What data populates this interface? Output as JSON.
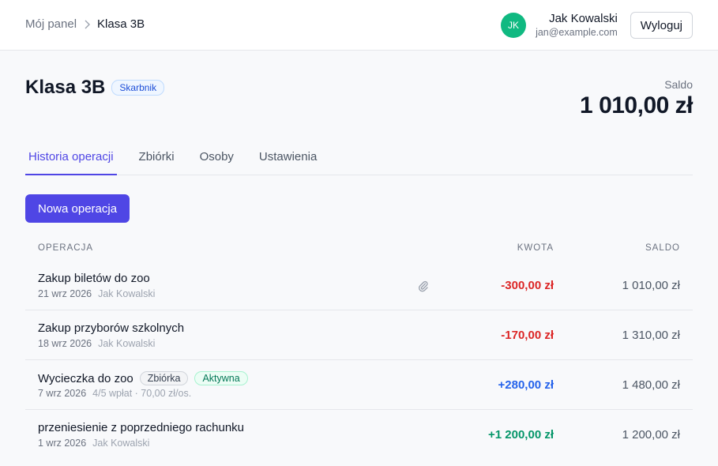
{
  "breadcrumb": {
    "home": "Mój panel",
    "current": "Klasa 3B"
  },
  "user": {
    "initials": "JK",
    "name": "Jak Kowalski",
    "email": "jan@example.com",
    "logout_label": "Wyloguj",
    "avatar_color": "#10b981"
  },
  "page": {
    "title": "Klasa 3B",
    "role_badge": "Skarbnik",
    "balance_label": "Saldo",
    "balance_value": "1 010,00 zł"
  },
  "tabs": [
    {
      "label": "Historia operacji",
      "active": true
    },
    {
      "label": "Zbiórki",
      "active": false
    },
    {
      "label": "Osoby",
      "active": false
    },
    {
      "label": "Ustawienia",
      "active": false
    }
  ],
  "new_operation_label": "Nowa operacja",
  "table": {
    "headers": {
      "operation": "OPERACJA",
      "amount": "KWOTA",
      "balance": "SALDO"
    },
    "rows": [
      {
        "title": "Zakup biletów do zoo",
        "date": "21 wrz 2026",
        "author": "Jak Kowalski",
        "amount": "-300,00 zł",
        "balance": "1 010,00 zł",
        "attachment_icon": "paperclip-icon"
      },
      {
        "title": "Zakup przyborów szkolnych",
        "date": "18 wrz 2026",
        "author": "Jak Kowalski",
        "amount": "-170,00 zł",
        "balance": "1 310,00 zł"
      },
      {
        "title": "Wycieczka do zoo",
        "chip_type": "Zbiórka",
        "chip_status": "Aktywna",
        "date": "7 wrz 2026",
        "extra": "4/5 wpłat · 70,00 zł/os.",
        "amount": "+280,00 zł",
        "balance": "1 480,00 zł"
      },
      {
        "title": "przeniesienie z poprzedniego rachunku",
        "date": "1 wrz 2026",
        "author": "Jak Kowalski",
        "amount": "+1 200,00 zł",
        "balance": "1 200,00 zł"
      }
    ]
  },
  "colors": {
    "accent": "#4f46e5",
    "negative": "#dc2626",
    "positive_collection": "#2563eb",
    "positive": "#059669"
  }
}
